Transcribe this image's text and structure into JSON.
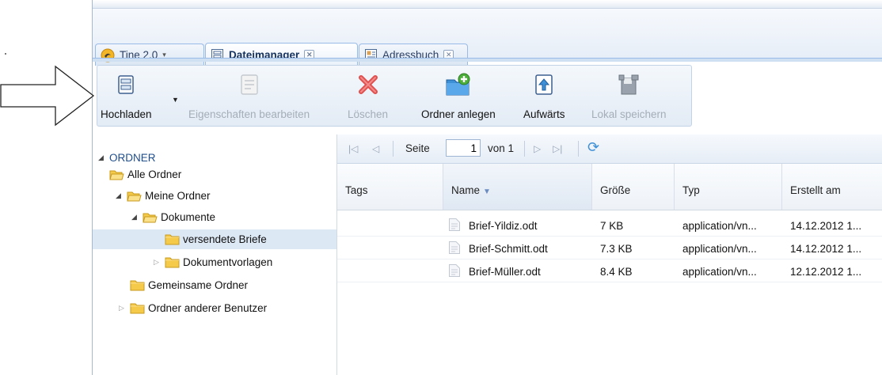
{
  "tabs": [
    {
      "label": "Tine 2.0",
      "icon": "tine-logo-icon",
      "caret": "▾"
    },
    {
      "label": "Dateimanager",
      "icon": "file-manager-icon",
      "close": "✕"
    },
    {
      "label": "Adressbuch",
      "icon": "address-book-icon",
      "close": "✕"
    }
  ],
  "toolbar": {
    "upload": "Hochladen",
    "edit_properties": "Eigenschaften bearbeiten",
    "delete": "Löschen",
    "new_folder": "Ordner anlegen",
    "up": "Aufwärts",
    "save_local": "Lokal speichern"
  },
  "tree": {
    "root": "ORDNER",
    "all_folders": "Alle Ordner",
    "my_folders": "Meine Ordner",
    "documents": "Dokumente",
    "sent_letters": "versendete Briefe",
    "templates": "Dokumentvorlagen",
    "shared": "Gemeinsame Ordner",
    "other_users": "Ordner anderer Benutzer",
    "expanded_glyph": "◢",
    "collapsed_glyph": "▷"
  },
  "pager": {
    "page_label": "Seite",
    "page_value": "1",
    "of_label": "von 1",
    "first": "|◁",
    "prev": "◁",
    "next": "▷",
    "last": "▷|",
    "refresh": "⟳"
  },
  "grid": {
    "columns": [
      "Tags",
      "Name",
      "Größe",
      "Typ",
      "Erstellt am"
    ],
    "sort_arrow": "▼",
    "rows": [
      {
        "tags": "",
        "name": "Brief-Yildiz.odt",
        "size": "7 KB",
        "type": "application/vn...",
        "created": "14.12.2012 1..."
      },
      {
        "tags": "",
        "name": "Brief-Schmitt.odt",
        "size": "7.3 KB",
        "type": "application/vn...",
        "created": "14.12.2012 1..."
      },
      {
        "tags": "",
        "name": "Brief-Müller.odt",
        "size": "8.4 KB",
        "type": "application/vn...",
        "created": "12.12.2012 1..."
      }
    ]
  },
  "colors": {
    "accent": "#99bbe8",
    "selection": "#dde8f5",
    "folder": "#f5c94a",
    "delete_red": "#e0504f",
    "new_folder_blue": "#3d8fd6",
    "new_folder_plus": "#4caf3a"
  }
}
